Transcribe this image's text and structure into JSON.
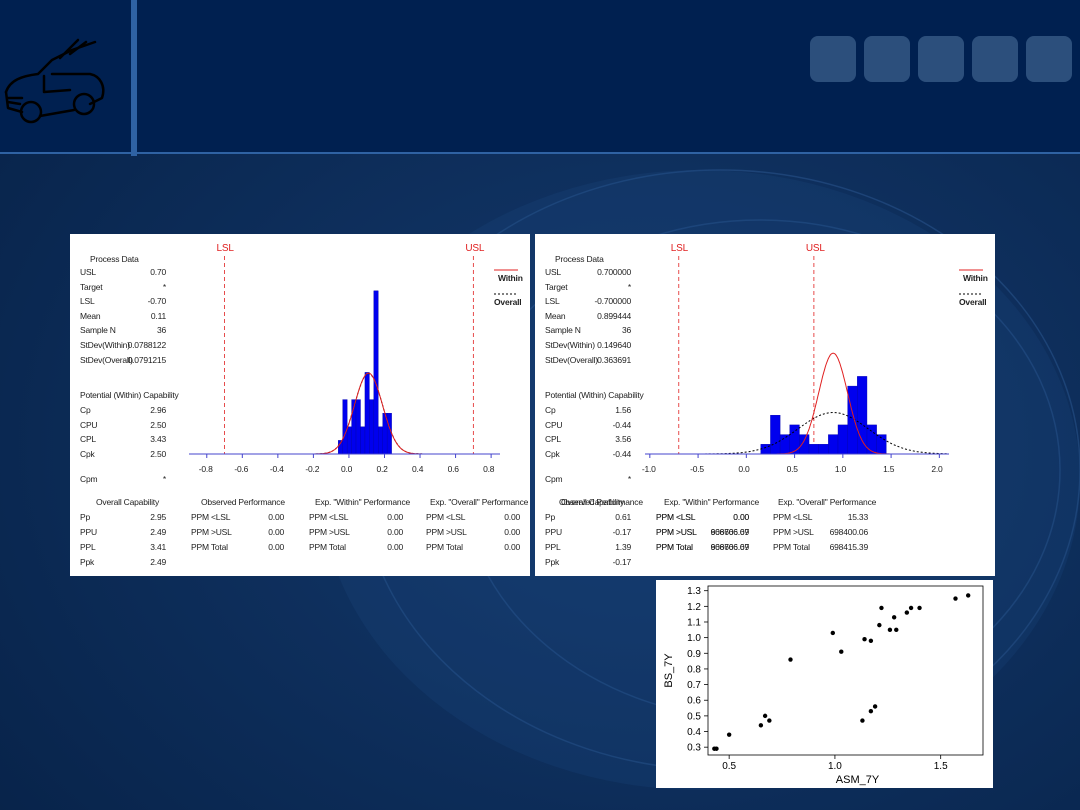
{
  "colors": {
    "background": "#0a2a55",
    "header": "#002050",
    "accent_bar": "#2f62a3",
    "spec": "#e02020",
    "bars": "#0000ee"
  },
  "icons": {
    "logo": "convertible-car-icon",
    "nav_squares": 5
  },
  "capability_left": {
    "lsl_label": "LSL",
    "usl_label": "USL",
    "process_data_title": "Process Data",
    "process_data": [
      {
        "k": "USL",
        "v": "0.70"
      },
      {
        "k": "Target",
        "v": "*"
      },
      {
        "k": "LSL",
        "v": "-0.70"
      },
      {
        "k": "Mean",
        "v": "0.11"
      },
      {
        "k": "Sample N",
        "v": "36"
      },
      {
        "k": "StDev(Within)",
        "v": "0.0788122"
      },
      {
        "k": "StDev(Overall)",
        "v": "0.0791215"
      }
    ],
    "potential_title": "Potential (Within) Capability",
    "potential": [
      {
        "k": "Cp",
        "v": "2.96"
      },
      {
        "k": "CPU",
        "v": "2.50"
      },
      {
        "k": "CPL",
        "v": "3.43"
      },
      {
        "k": "Cpk",
        "v": "2.50"
      }
    ],
    "cpm": {
      "k": "Cpm",
      "v": "*"
    },
    "legend": {
      "within": "Within",
      "overall": "Overall"
    },
    "ticks": [
      "-0.8",
      "-0.6",
      "-0.4",
      "-0.2",
      "0.0",
      "0.2",
      "0.4",
      "0.6",
      "0.8"
    ],
    "overall_title": "Overall Capability",
    "overall": [
      {
        "k": "Pp",
        "v": "2.95"
      },
      {
        "k": "PPU",
        "v": "2.49"
      },
      {
        "k": "PPL",
        "v": "3.41"
      },
      {
        "k": "Ppk",
        "v": "2.49"
      }
    ],
    "observed_title": "Observed Performance",
    "observed": [
      {
        "k": "PPM <LSL",
        "v": "0.00"
      },
      {
        "k": "PPM >USL",
        "v": "0.00"
      },
      {
        "k": "PPM Total",
        "v": "0.00"
      }
    ],
    "within_title": "Exp. \"Within\" Performance",
    "within": [
      {
        "k": "PPM <LSL",
        "v": "0.00"
      },
      {
        "k": "PPM >USL",
        "v": "0.00"
      },
      {
        "k": "PPM Total",
        "v": "0.00"
      }
    ],
    "overall_perf_title": "Exp. \"Overall\" Performance",
    "overall_perf": [
      {
        "k": "PPM <LSL",
        "v": "0.00"
      },
      {
        "k": "PPM >USL",
        "v": "0.00"
      },
      {
        "k": "PPM Total",
        "v": "0.00"
      }
    ]
  },
  "capability_right": {
    "lsl_label": "LSL",
    "usl_label": "USL",
    "process_data_title": "Process Data",
    "process_data": [
      {
        "k": "USL",
        "v": "0.700000"
      },
      {
        "k": "Target",
        "v": "*"
      },
      {
        "k": "LSL",
        "v": "-0.700000"
      },
      {
        "k": "Mean",
        "v": "0.899444"
      },
      {
        "k": "Sample N",
        "v": "36"
      },
      {
        "k": "StDev(Within)",
        "v": "0.149640"
      },
      {
        "k": "StDev(Overall)",
        "v": "0.363691"
      }
    ],
    "potential_title": "Potential (Within) Capability",
    "potential": [
      {
        "k": "Cp",
        "v": "1.56"
      },
      {
        "k": "CPU",
        "v": "-0.44"
      },
      {
        "k": "CPL",
        "v": "3.56"
      },
      {
        "k": "Cpk",
        "v": "-0.44"
      }
    ],
    "cpm": {
      "k": "Cpm",
      "v": "*"
    },
    "legend": {
      "within": "Within",
      "overall": "Overall"
    },
    "ticks": [
      "-1.0",
      "-0.5",
      "0.0",
      "0.5",
      "1.0",
      "1.5",
      "2.0"
    ],
    "overall_title": "Overall Capability",
    "overall": [
      {
        "k": "Pp",
        "v": "0.61"
      },
      {
        "k": "PPU",
        "v": "-0.17"
      },
      {
        "k": "PPL",
        "v": "1.39"
      },
      {
        "k": "Ppk",
        "v": "-0.17"
      }
    ],
    "observed_title": "Observed Performance",
    "observed": [
      {
        "k": "PPM <LSL",
        "v": "0.00"
      },
      {
        "k": "PPM >USL",
        "v": "666666.67"
      },
      {
        "k": "PPM Total",
        "v": "666666.67"
      }
    ],
    "within_title": "Exp. \"Within\" Performance",
    "within": [
      {
        "k": "PPM <LSL",
        "v": "0.00"
      },
      {
        "k": "PPM >USL",
        "v": "908706.09"
      },
      {
        "k": "PPM Total",
        "v": "908706.09"
      }
    ],
    "overall_perf_title": "Exp. \"Overall\" Performance",
    "overall_perf": [
      {
        "k": "PPM <LSL",
        "v": "15.33"
      },
      {
        "k": "PPM >USL",
        "v": "698400.06"
      },
      {
        "k": "PPM Total",
        "v": "698415.39"
      }
    ]
  },
  "chart_data": [
    {
      "type": "bar",
      "subtype": "capability-histogram",
      "xlim": [
        -0.9,
        0.85
      ],
      "lsl": -0.7,
      "usl": 0.7,
      "mean": 0.11,
      "sd_within": 0.0788122,
      "sd_overall": 0.0791215,
      "bins": [
        {
          "x0": -0.06,
          "x1": -0.035,
          "count": 1
        },
        {
          "x0": -0.035,
          "x1": -0.01,
          "count": 4
        },
        {
          "x0": -0.01,
          "x1": 0.015,
          "count": 2
        },
        {
          "x0": 0.015,
          "x1": 0.04,
          "count": 4
        },
        {
          "x0": 0.04,
          "x1": 0.065,
          "count": 4
        },
        {
          "x0": 0.065,
          "x1": 0.09,
          "count": 2
        },
        {
          "x0": 0.09,
          "x1": 0.115,
          "count": 6
        },
        {
          "x0": 0.115,
          "x1": 0.14,
          "count": 4
        },
        {
          "x0": 0.14,
          "x1": 0.165,
          "count": 12
        },
        {
          "x0": 0.165,
          "x1": 0.19,
          "count": 2
        },
        {
          "x0": 0.19,
          "x1": 0.215,
          "count": 3
        },
        {
          "x0": 0.215,
          "x1": 0.24,
          "count": 3
        }
      ]
    },
    {
      "type": "bar",
      "subtype": "capability-histogram",
      "xlim": [
        -1.05,
        2.1
      ],
      "lsl": -0.7,
      "usl": 0.7,
      "mean": 0.899444,
      "sd_within": 0.14964,
      "sd_overall": 0.363691,
      "bins": [
        {
          "x0": 0.15,
          "x1": 0.25,
          "count": 1
        },
        {
          "x0": 0.25,
          "x1": 0.35,
          "count": 4
        },
        {
          "x0": 0.35,
          "x1": 0.45,
          "count": 2
        },
        {
          "x0": 0.45,
          "x1": 0.55,
          "count": 3
        },
        {
          "x0": 0.55,
          "x1": 0.65,
          "count": 2
        },
        {
          "x0": 0.65,
          "x1": 0.75,
          "count": 1
        },
        {
          "x0": 0.75,
          "x1": 0.85,
          "count": 1
        },
        {
          "x0": 0.85,
          "x1": 0.95,
          "count": 2
        },
        {
          "x0": 0.95,
          "x1": 1.05,
          "count": 3
        },
        {
          "x0": 1.05,
          "x1": 1.15,
          "count": 7
        },
        {
          "x0": 1.15,
          "x1": 1.25,
          "count": 8
        },
        {
          "x0": 1.25,
          "x1": 1.35,
          "count": 3
        },
        {
          "x0": 1.35,
          "x1": 1.45,
          "count": 2
        }
      ]
    },
    {
      "type": "scatter",
      "xlabel": "ASM_7Y",
      "ylabel": "BS_7Y",
      "xlim": [
        0.4,
        1.7
      ],
      "ylim": [
        0.25,
        1.33
      ],
      "xticks": [
        0.5,
        1.0,
        1.5
      ],
      "yticks": [
        0.3,
        0.4,
        0.5,
        0.6,
        0.7,
        0.8,
        0.9,
        1.0,
        1.1,
        1.2,
        1.3
      ],
      "points": [
        [
          0.43,
          0.29
        ],
        [
          0.44,
          0.29
        ],
        [
          0.5,
          0.38
        ],
        [
          0.65,
          0.44
        ],
        [
          0.67,
          0.5
        ],
        [
          0.69,
          0.47
        ],
        [
          0.79,
          0.86
        ],
        [
          0.99,
          1.03
        ],
        [
          1.03,
          0.91
        ],
        [
          1.13,
          0.47
        ],
        [
          1.14,
          0.99
        ],
        [
          1.17,
          0.98
        ],
        [
          1.17,
          0.53
        ],
        [
          1.19,
          0.56
        ],
        [
          1.21,
          1.08
        ],
        [
          1.22,
          1.19
        ],
        [
          1.26,
          1.05
        ],
        [
          1.28,
          1.13
        ],
        [
          1.29,
          1.05
        ],
        [
          1.34,
          1.16
        ],
        [
          1.36,
          1.19
        ],
        [
          1.4,
          1.19
        ],
        [
          1.57,
          1.25
        ],
        [
          1.63,
          1.27
        ]
      ]
    }
  ]
}
